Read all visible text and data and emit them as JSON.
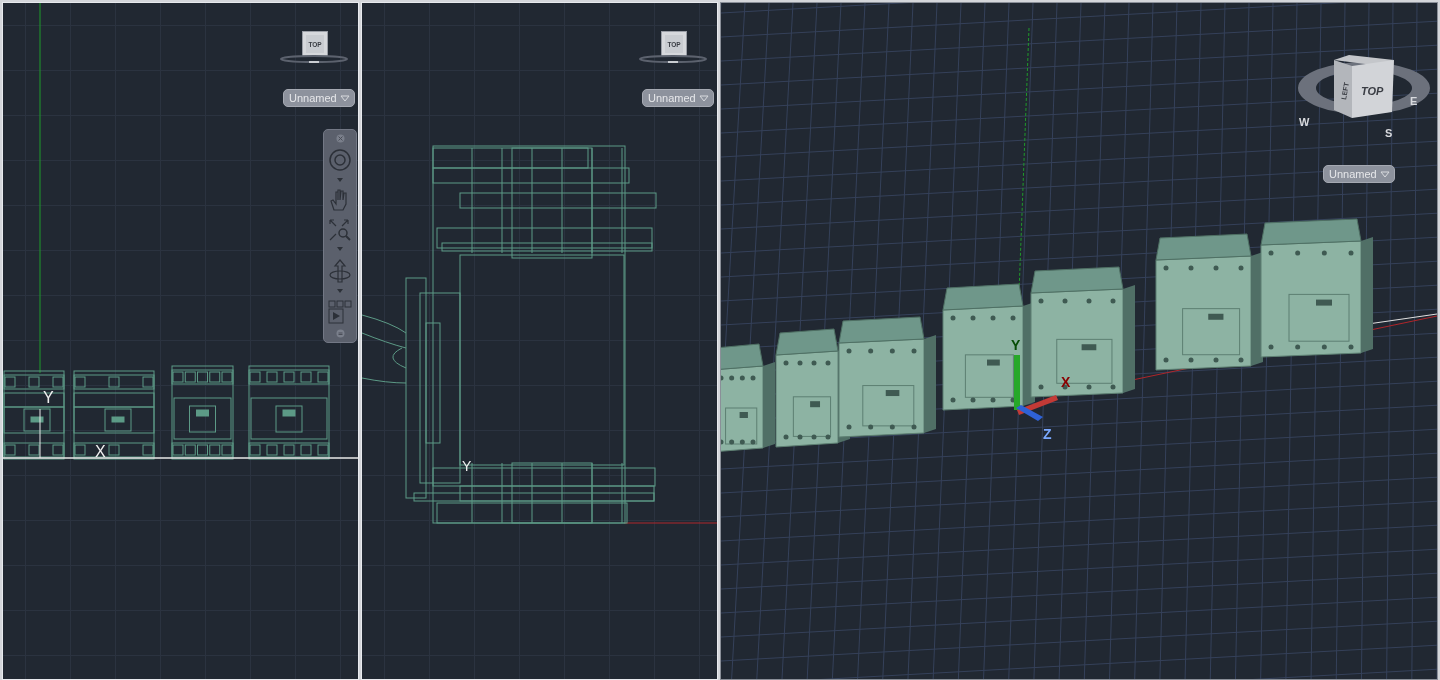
{
  "viewports": [
    {
      "kind": "front",
      "view_cube": {
        "face": "TOP"
      },
      "view_menu": "Unnamed",
      "nav_bar": true,
      "ucs_labels": [
        "Y",
        "X"
      ]
    },
    {
      "kind": "side",
      "view_cube": {
        "face": "TOP"
      },
      "view_menu": "Unnamed",
      "nav_bar": false,
      "ucs_labels": [
        "Y"
      ]
    },
    {
      "kind": "iso",
      "view_cube": {
        "face": "TOP",
        "side": "LEFT",
        "compass": [
          "W",
          "S",
          "E"
        ]
      },
      "view_menu": "Unnamed",
      "nav_bar": false,
      "ucs_labels": [
        "Y",
        "X",
        "Z"
      ]
    }
  ]
}
